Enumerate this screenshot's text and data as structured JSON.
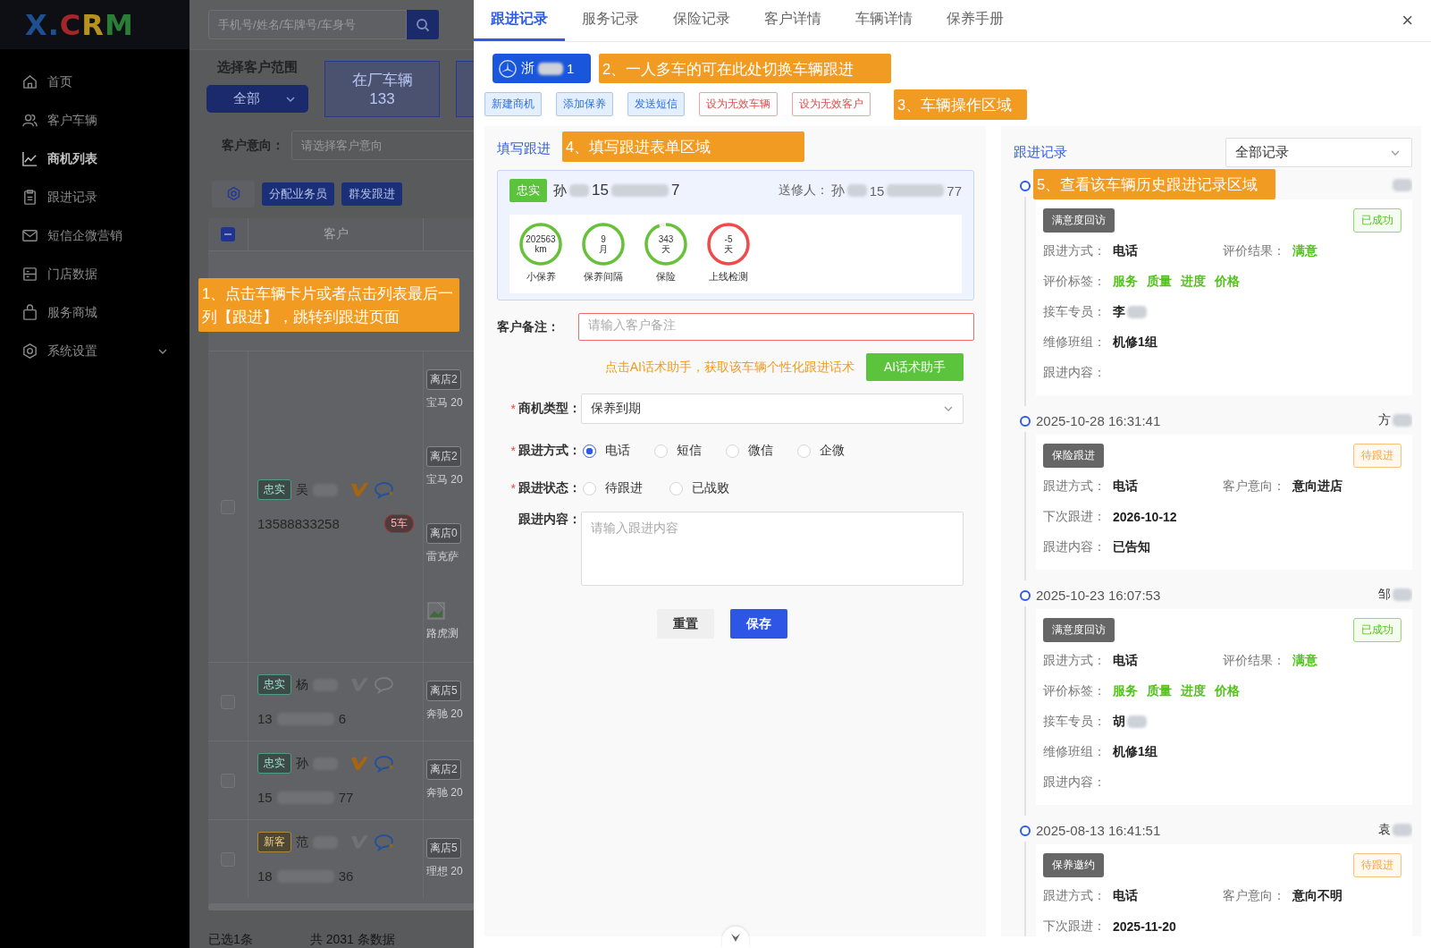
{
  "sidebar": {
    "logo": [
      {
        "text": "X",
        "color": "#1d4f91"
      },
      {
        "text": ".",
        "color": "#1d4f91"
      },
      {
        "text": "C",
        "color": "#a3262a"
      },
      {
        "text": "R",
        "color": "#b8921f"
      },
      {
        "text": "M",
        "color": "#2a7d36"
      }
    ],
    "items": [
      {
        "label": "首页",
        "kind": "home",
        "selected": false
      },
      {
        "label": "客户车辆",
        "kind": "users",
        "selected": false
      },
      {
        "label": "商机列表",
        "kind": "chart",
        "selected": true
      },
      {
        "label": "跟进记录",
        "kind": "clipboard",
        "selected": false
      },
      {
        "label": "短信企微营销",
        "kind": "mail",
        "selected": false
      },
      {
        "label": "门店数据",
        "kind": "panel",
        "selected": false
      },
      {
        "label": "服务商城",
        "kind": "bag",
        "selected": false
      },
      {
        "label": "系统设置",
        "kind": "settings",
        "selected": false,
        "expandable": true
      }
    ]
  },
  "search": {
    "placeholder": "手机号/姓名/车牌号/车身号"
  },
  "filters": {
    "scope_label": "选择客户范围",
    "scope_value": "全部",
    "stat_cards": [
      {
        "label": "在厂车辆",
        "value": "133"
      }
    ],
    "intent_label": "客户意向：",
    "intent_placeholder": "请选择客户意向"
  },
  "toolbar": {
    "buttons": [
      "分配业务员",
      "群发跟进"
    ]
  },
  "table": {
    "header_indeterminate": true,
    "columns": [
      "客户"
    ],
    "rows": [
      {
        "checked": false,
        "tag": {
          "text": "忠实",
          "kind": "loyal"
        },
        "name": "吴",
        "vip": true,
        "wechat": true,
        "phone": {
          "head": "13588833258"
        },
        "badge": "5车",
        "vehicles": [
          {
            "kind": "tag",
            "tag": "离店2",
            "model": "宝马 20"
          },
          {
            "kind": "tag",
            "tag": "离店2",
            "model": "宝马 20"
          },
          {
            "kind": "tag",
            "tag": "离店0",
            "model": "雷克萨"
          },
          {
            "kind": "image",
            "model": "路虎测"
          }
        ]
      },
      {
        "checked": false,
        "tag": {
          "text": "忠实",
          "kind": "loyal"
        },
        "name": "杨",
        "vip": false,
        "wechat": false,
        "phone": {
          "head": "13",
          "tail": "6",
          "redacted": true
        },
        "vehicles": [
          {
            "kind": "tag",
            "tag": "离店5",
            "model": "奔驰 20"
          }
        ]
      },
      {
        "checked": false,
        "tag": {
          "text": "忠实",
          "kind": "loyal"
        },
        "name": "孙",
        "vip": true,
        "wechat": true,
        "phone": {
          "head": "15",
          "tail": "77",
          "redacted": true
        },
        "vehicles": [
          {
            "kind": "tag",
            "tag": "离店2",
            "model": "奔驰 20"
          }
        ]
      },
      {
        "checked": false,
        "tag": {
          "text": "新客",
          "kind": "new"
        },
        "name": "范",
        "vip": false,
        "wechat": true,
        "phone": {
          "head": "18",
          "tail": "36",
          "redacted": true
        },
        "vehicles": [
          {
            "kind": "tag",
            "tag": "离店5",
            "model": "理想 20"
          }
        ]
      }
    ]
  },
  "footer": {
    "selected": "已选1条",
    "total": "共 2031 条数据"
  },
  "drawer": {
    "tabs": [
      {
        "label": "跟进记录",
        "selected": true
      },
      {
        "label": "服务记录",
        "selected": false
      },
      {
        "label": "保险记录",
        "selected": false
      },
      {
        "label": "客户详情",
        "selected": false
      },
      {
        "label": "车辆详情",
        "selected": false
      },
      {
        "label": "保养手册",
        "selected": false
      }
    ],
    "close": "×",
    "vehicle": {
      "head": "浙",
      "tail": "1",
      "selected": true
    },
    "actions": [
      {
        "label": "新建商机",
        "kind": "primary"
      },
      {
        "label": "添加保养",
        "kind": "primary"
      },
      {
        "label": "发送短信",
        "kind": "primary"
      },
      {
        "label": "设为无效车辆",
        "kind": "danger"
      },
      {
        "label": "设为无效客户",
        "kind": "danger"
      }
    ],
    "form": {
      "title": "填写跟进",
      "customer": {
        "tag": "忠实",
        "name": "孙",
        "phone_head": "15",
        "phone_tail": "7",
        "repair_label": "送修人：",
        "repair_name": "孙",
        "repair_phone_head": "15",
        "repair_phone_tail": "77"
      },
      "gauges": [
        {
          "value": "202563",
          "unit": "km",
          "label": "小保养",
          "level": 1,
          "color": "#67c23a"
        },
        {
          "value": "9",
          "unit": "月",
          "label": "保养间隔",
          "level": 1,
          "color": "#67c23a"
        },
        {
          "value": "343",
          "unit": "天",
          "label": "保险",
          "level": 0.94,
          "color": "#67c23a"
        },
        {
          "value": "-5",
          "unit": "天",
          "label": "上线检测",
          "level": 1,
          "color": "#f04b4b"
        }
      ],
      "remark": {
        "label": "客户备注：",
        "placeholder": "请输入客户备注",
        "invalid": true
      },
      "ai_hint": "点击AI话术助手，获取该车辆个性化跟进话术",
      "ai_button": "AI话术助手",
      "type": {
        "mark": "*",
        "label": "商机类型：",
        "value": "保养到期"
      },
      "method": {
        "mark": "*",
        "label": "跟进方式：",
        "options": [
          {
            "label": "电话",
            "selected": true
          },
          {
            "label": "短信",
            "selected": false
          },
          {
            "label": "微信",
            "selected": false
          },
          {
            "label": "企微",
            "selected": false
          }
        ]
      },
      "status": {
        "mark": "*",
        "label": "跟进状态：",
        "options": [
          {
            "label": "待跟进",
            "selected": false
          },
          {
            "label": "已战败",
            "selected": false
          }
        ]
      },
      "content": {
        "label": "跟进内容：",
        "placeholder": "请输入跟进内容"
      },
      "buttons": [
        {
          "label": "重置",
          "kind": "default"
        },
        {
          "label": "保存",
          "kind": "primary"
        }
      ]
    },
    "history": {
      "title": "跟进记录",
      "filter": "全部记录",
      "entries": [
        {
          "person": {
            "redacted": true
          },
          "tag": "满意度回访",
          "status": {
            "text": "已成功",
            "kind": "success"
          },
          "rows": [
            [
              {
                "label": "跟进方式：",
                "value": "电话"
              },
              {
                "label": "评价结果：",
                "value": "满意",
                "positive": true
              }
            ],
            [
              {
                "label": "评价标签：",
                "tags": [
                  "服务",
                  "质量",
                  "进度",
                  "价格"
                ]
              }
            ],
            [
              {
                "label": "接车专员：",
                "value": "李",
                "redacted": true
              }
            ],
            [
              {
                "label": "维修班组：",
                "value": "机修1组"
              }
            ],
            [
              {
                "label": "跟进内容："
              }
            ]
          ]
        },
        {
          "date": "2025-10-28 16:31:41",
          "person": {
            "name": "方",
            "redacted": true
          },
          "tag": "保险跟进",
          "status": {
            "text": "待跟进",
            "kind": "pending"
          },
          "rows": [
            [
              {
                "label": "跟进方式：",
                "value": "电话"
              },
              {
                "label": "客户意向：",
                "value": "意向进店"
              }
            ],
            [
              {
                "label": "下次跟进：",
                "value": "2026-10-12"
              }
            ],
            [
              {
                "label": "跟进内容：",
                "value": "已告知"
              }
            ]
          ]
        },
        {
          "date": "2025-10-23 16:07:53",
          "person": {
            "name": "邹",
            "redacted": true
          },
          "tag": "满意度回访",
          "status": {
            "text": "已成功",
            "kind": "success"
          },
          "rows": [
            [
              {
                "label": "跟进方式：",
                "value": "电话"
              },
              {
                "label": "评价结果：",
                "value": "满意",
                "positive": true
              }
            ],
            [
              {
                "label": "评价标签：",
                "tags": [
                  "服务",
                  "质量",
                  "进度",
                  "价格"
                ]
              }
            ],
            [
              {
                "label": "接车专员：",
                "value": "胡",
                "redacted": true
              }
            ],
            [
              {
                "label": "维修班组：",
                "value": "机修1组"
              }
            ],
            [
              {
                "label": "跟进内容："
              }
            ]
          ]
        },
        {
          "date": "2025-08-13 16:41:51",
          "person": {
            "name": "袁",
            "redacted": true
          },
          "tag": "保养邀约",
          "status": {
            "text": "待跟进",
            "kind": "pending"
          },
          "rows": [
            [
              {
                "label": "跟进方式：",
                "value": "电话"
              },
              {
                "label": "客户意向：",
                "value": "意向不明"
              }
            ],
            [
              {
                "label": "下次跟进：",
                "value": "2025-11-20"
              }
            ]
          ]
        }
      ]
    }
  },
  "annotations": [
    {
      "text": "1、点击车辆卡片或者点击列表最后一列【跟进】，跳转到跟进页面"
    },
    {
      "text": "2、一人多车的可在此处切换车辆跟进"
    },
    {
      "text": "3、车辆操作区域"
    },
    {
      "text": "4、填写跟进表单区域"
    },
    {
      "text": "5、查看该车辆历史跟进记录区域"
    }
  ]
}
